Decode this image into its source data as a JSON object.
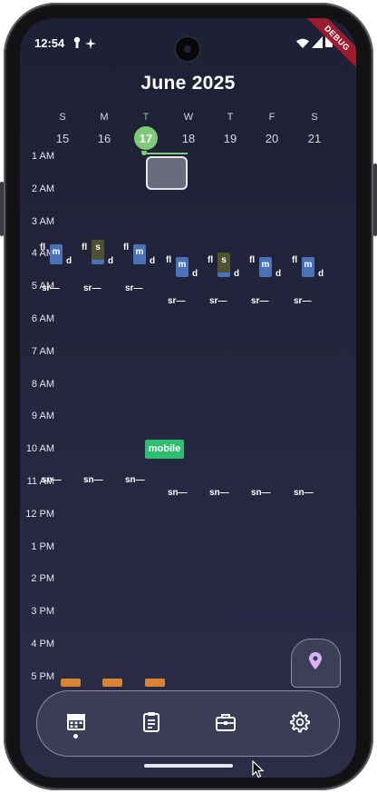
{
  "status_bar": {
    "time": "12:54"
  },
  "debug_banner": "DEBUG",
  "calendar": {
    "month_title": "June 2025",
    "days": [
      {
        "dow": "S",
        "date": "15",
        "today": false
      },
      {
        "dow": "M",
        "date": "16",
        "today": false
      },
      {
        "dow": "T",
        "date": "17",
        "today": true
      },
      {
        "dow": "W",
        "date": "18",
        "today": false
      },
      {
        "dow": "T",
        "date": "19",
        "today": false
      },
      {
        "dow": "F",
        "date": "20",
        "today": false
      },
      {
        "dow": "S",
        "date": "21",
        "today": false
      }
    ],
    "hours": [
      "1 AM",
      "2 AM",
      "3 AM",
      "4 AM",
      "5 AM",
      "6 AM",
      "7 AM",
      "8 AM",
      "9 AM",
      "10 AM",
      "11 AM",
      "12 PM",
      "1 PM",
      "2 PM",
      "3 PM",
      "4 PM",
      "5 PM"
    ],
    "prayer_labels": {
      "fl": "fl",
      "m": "m",
      "d": "d",
      "s": "s",
      "sunrise": "sr—",
      "sunset": "sn—"
    },
    "mobile_event": "mobile"
  },
  "colors": {
    "today": "#7fc97a",
    "event_blue": "#4a72b8",
    "event_olive": "#4e5231",
    "event_green": "#2fbe6f",
    "event_orange": "#d98435"
  },
  "nav": {
    "items": [
      {
        "name": "calendar",
        "icon": "calendar-icon",
        "active": true
      },
      {
        "name": "tasks",
        "icon": "clipboard-icon",
        "active": false
      },
      {
        "name": "work",
        "icon": "briefcase-icon",
        "active": false
      },
      {
        "name": "settings",
        "icon": "gear-icon",
        "active": false
      }
    ]
  },
  "fab_icon": "map-pin-icon"
}
